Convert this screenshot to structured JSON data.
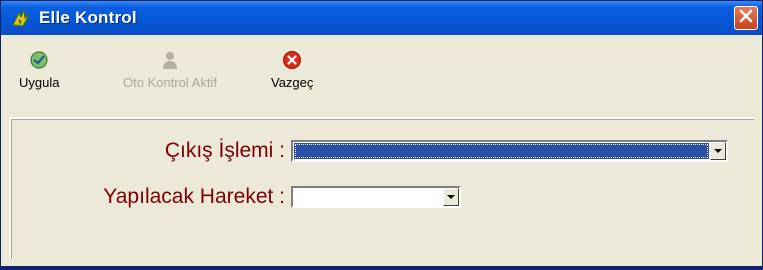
{
  "window": {
    "title": "Elle Kontrol"
  },
  "toolbar": {
    "apply_label": "Uygula",
    "auto_control_label": "Oto Kontrol Aktif",
    "cancel_label": "Vazgeç"
  },
  "form": {
    "exit_operation_label": "Çıkış İşlemi :",
    "exit_operation_value": "",
    "action_label": "Yapılacak Hareket :",
    "action_value": ""
  },
  "colors": {
    "title_bar": "#0557d6",
    "label_text": "#800000",
    "selection": "#2c4fa8",
    "close_button": "#d24a26"
  },
  "icons": {
    "app": "bird-logo-icon",
    "apply": "check-circle-icon",
    "auto_control": "user-icon",
    "cancel": "cancel-circle-icon",
    "close": "close-icon"
  }
}
